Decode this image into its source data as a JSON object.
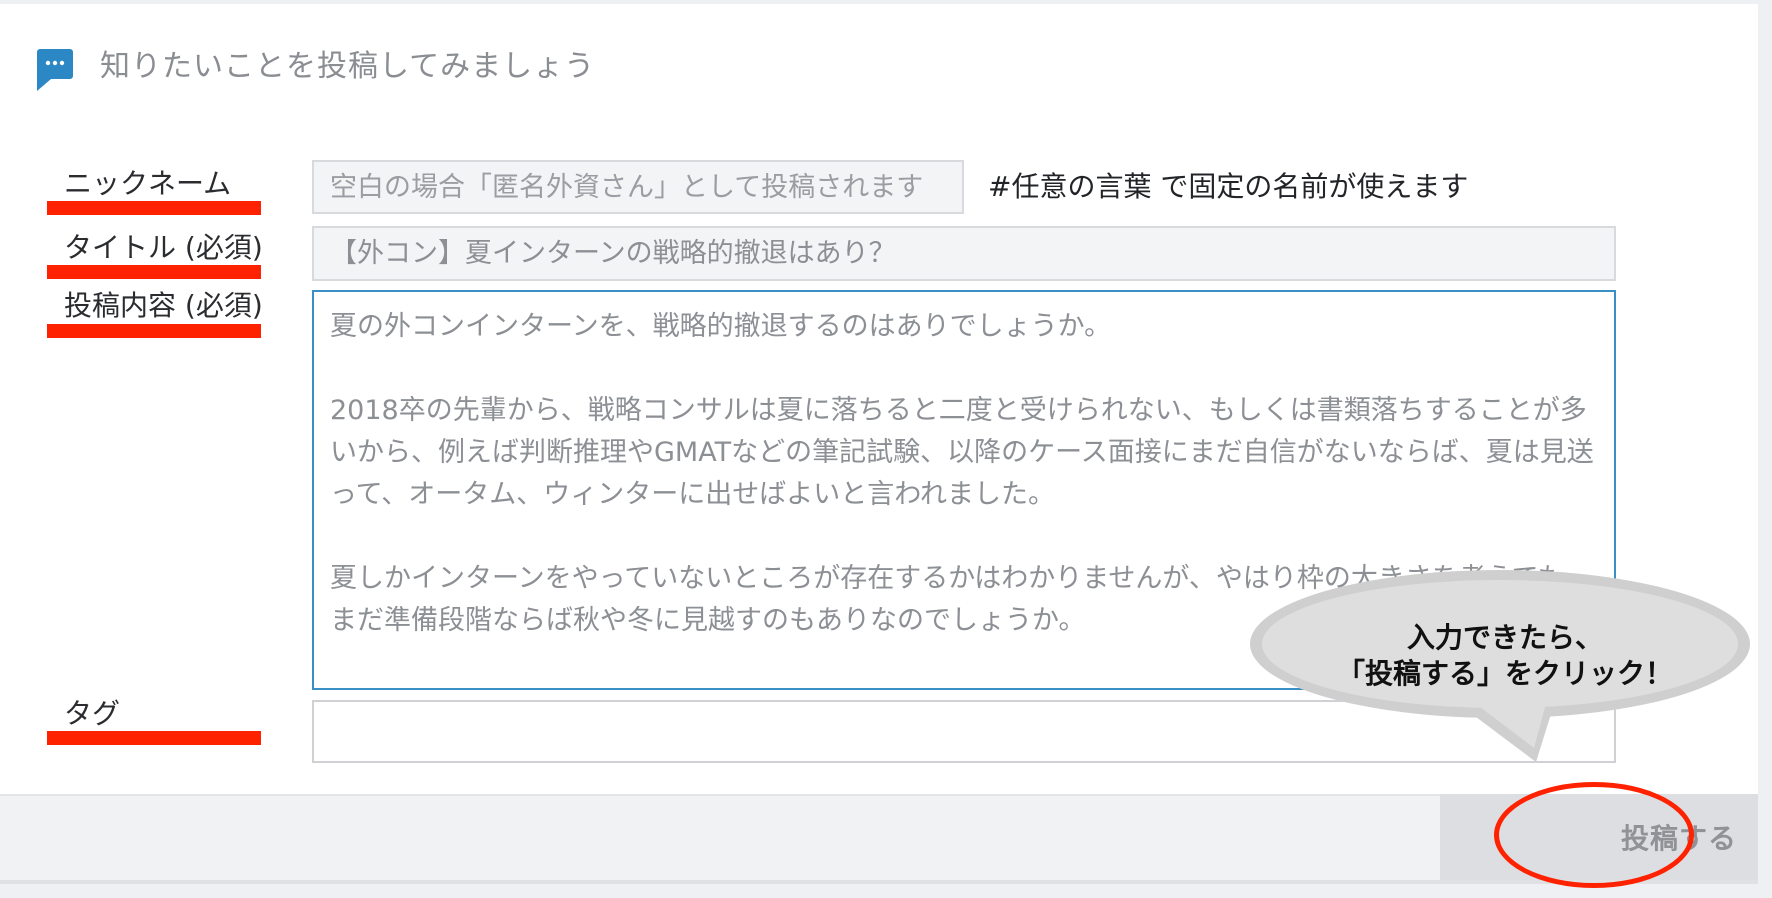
{
  "header": {
    "title": "知りたいことを投稿してみましょう",
    "icon": "chat-bubble-icon",
    "accent_color": "#2b88c4"
  },
  "form": {
    "nickname": {
      "label": "ニックネーム",
      "placeholder": "空白の場合「匿名外資さん」として投稿されます",
      "hint": "#任意の言葉 で固定の名前が使えます"
    },
    "title": {
      "label": "タイトル (必須)",
      "value": "【外コン】夏インターンの戦略的撤退はあり？"
    },
    "body": {
      "label": "投稿内容 (必須)",
      "value": "夏の外コンインターンを、戦略的撤退するのはありでしょうか。\n\n2018卒の先輩から、戦略コンサルは夏に落ちると二度と受けられない、もしくは書類落ちすることが多いから、例えば判断推理やGMATなどの筆記試験、以降のケース面接にまだ自信がないならば、夏は見送って、オータム、ウィンターに出せばよいと言われました。\n\n夏しかインターンをやっていないところが存在するかはわかりませんが、やはり枠の大きさを考えても、まだ準備段階ならば秋や冬に見越すのもありなのでしょうか。"
    },
    "tag": {
      "label": "タグ",
      "value": ""
    },
    "submit_label": "投稿する"
  },
  "annotation": {
    "callout_line1": "入力できたら、",
    "callout_line2": "「投稿する」をクリック！",
    "highlight_color": "#ff2200"
  }
}
